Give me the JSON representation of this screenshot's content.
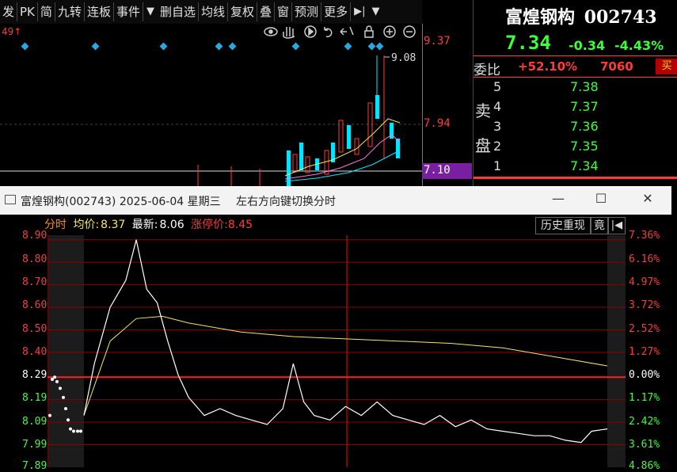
{
  "toolbar": {
    "items": [
      "发",
      "PK",
      "简",
      "九转",
      "连板",
      "事件",
      "删自选",
      "均线",
      "复权",
      "叠",
      "窗",
      "预测",
      "更多"
    ]
  },
  "bg_chart": {
    "left_label": "49↑",
    "high_label": "9.08",
    "axis_prices": [
      "9.37",
      "7.94",
      "7.10"
    ]
  },
  "quote": {
    "name": "富煌钢构",
    "code": "002743",
    "price": "7.34",
    "change": "-0.34",
    "change_pct": "-4.43%",
    "weibi_label": "委比",
    "weibi_value": "+52.10%",
    "weicha_value": "7060",
    "buy_tag": "买",
    "sell_chars": [
      "卖",
      "盘"
    ],
    "asks": [
      {
        "level": "5",
        "price": "7.38"
      },
      {
        "level": "4",
        "price": "7.37"
      },
      {
        "level": "3",
        "price": "7.36"
      },
      {
        "level": "2",
        "price": "7.35"
      },
      {
        "level": "1",
        "price": "7.34"
      }
    ]
  },
  "popup": {
    "title": "富煌钢构(002743) 2025-06-04 星期三",
    "hint": "左右方向键切换分时",
    "info": {
      "mode": "分时",
      "avg_label": "均价:",
      "avg_value": "8.37",
      "latest_label": "最新:",
      "latest_value": "8.06",
      "limit_label": "涨停价:",
      "limit_value": "8.45"
    },
    "history_button": "历史重现",
    "jing_button": "竟",
    "left_axis": [
      "8.90",
      "8.80",
      "8.70",
      "8.60",
      "8.50",
      "8.40",
      "8.29",
      "8.19",
      "8.09",
      "7.99",
      "7.89"
    ],
    "right_axis": [
      "7.36%",
      "6.16%",
      "4.97%",
      "3.72%",
      "2.52%",
      "1.27%",
      "0.00%",
      "1.17%",
      "2.42%",
      "3.61%",
      "4.86%"
    ]
  },
  "chart_data": {
    "type": "line",
    "title": "",
    "prev_close": 8.29,
    "ylim": [
      7.89,
      8.92
    ],
    "series": [
      {
        "name": "",
        "x_frac": [
          0,
          0.02,
          0.05,
          0.08,
          0.1,
          0.12,
          0.14,
          0.16,
          0.18,
          0.2,
          0.23,
          0.26,
          0.29,
          0.32,
          0.35,
          0.38,
          0.4,
          0.42,
          0.44,
          0.47,
          0.5,
          0.53,
          0.56,
          0.59,
          0.62,
          0.65,
          0.68,
          0.71,
          0.74,
          0.77,
          0.8,
          0.83,
          0.86,
          0.89,
          0.92,
          0.95,
          0.97,
          1.0
        ],
        "values": [
          8.12,
          8.35,
          8.6,
          8.72,
          8.9,
          8.68,
          8.62,
          8.45,
          8.3,
          8.2,
          8.12,
          8.15,
          8.12,
          8.1,
          8.08,
          8.15,
          8.35,
          8.18,
          8.12,
          8.1,
          8.16,
          8.12,
          8.18,
          8.12,
          8.1,
          8.08,
          8.12,
          8.07,
          8.1,
          8.06,
          8.05,
          8.04,
          8.03,
          8.03,
          8.01,
          8.0,
          8.05,
          8.06
        ]
      },
      {
        "name": "",
        "x_frac": [
          0,
          0.05,
          0.1,
          0.15,
          0.2,
          0.3,
          0.4,
          0.5,
          0.6,
          0.7,
          0.8,
          0.9,
          1.0
        ],
        "values": [
          8.12,
          8.45,
          8.55,
          8.56,
          8.53,
          8.49,
          8.47,
          8.46,
          8.45,
          8.44,
          8.42,
          8.38,
          8.34
        ]
      }
    ]
  }
}
